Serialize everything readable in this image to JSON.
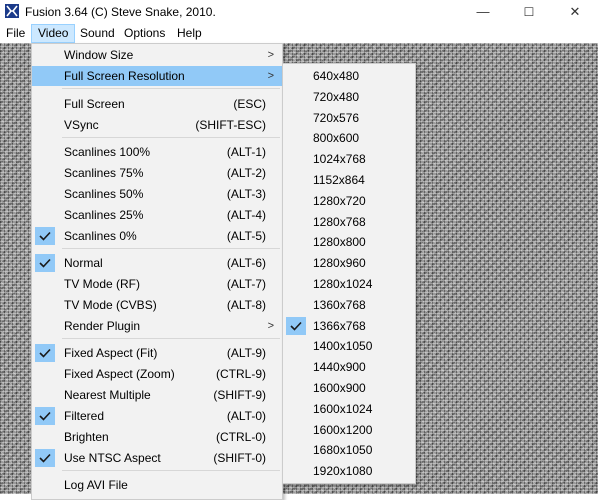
{
  "window": {
    "title": "Fusion 3.64 (C) Steve Snake, 2010.",
    "minimize": "—",
    "maximize": "☐",
    "close": "✕"
  },
  "menubar": [
    "File",
    "Video",
    "Sound",
    "Options",
    "Help"
  ],
  "video_menu": {
    "items": [
      {
        "label": "Window Size",
        "shortcut": "",
        "checked": false,
        "submenu": true
      },
      {
        "label": "Full Screen Resolution",
        "shortcut": "",
        "checked": false,
        "submenu": true,
        "highlighted": true
      },
      {
        "label": "Full Screen",
        "shortcut": "(ESC)",
        "checked": false
      },
      {
        "label": "VSync",
        "shortcut": "(SHIFT-ESC)",
        "checked": false
      },
      {
        "label": "Scanlines 100%",
        "shortcut": "(ALT-1)",
        "checked": false
      },
      {
        "label": "Scanlines 75%",
        "shortcut": "(ALT-2)",
        "checked": false
      },
      {
        "label": "Scanlines 50%",
        "shortcut": "(ALT-3)",
        "checked": false
      },
      {
        "label": "Scanlines 25%",
        "shortcut": "(ALT-4)",
        "checked": false
      },
      {
        "label": "Scanlines 0%",
        "shortcut": "(ALT-5)",
        "checked": true
      },
      {
        "label": "Normal",
        "shortcut": "(ALT-6)",
        "checked": true
      },
      {
        "label": "TV Mode (RF)",
        "shortcut": "(ALT-7)",
        "checked": false
      },
      {
        "label": "TV Mode (CVBS)",
        "shortcut": "(ALT-8)",
        "checked": false
      },
      {
        "label": "Render Plugin",
        "shortcut": "",
        "checked": false,
        "submenu": true
      },
      {
        "label": "Fixed Aspect (Fit)",
        "shortcut": "(ALT-9)",
        "checked": true
      },
      {
        "label": "Fixed Aspect (Zoom)",
        "shortcut": "(CTRL-9)",
        "checked": false
      },
      {
        "label": "Nearest Multiple",
        "shortcut": "(SHIFT-9)",
        "checked": false
      },
      {
        "label": "Filtered",
        "shortcut": "(ALT-0)",
        "checked": true
      },
      {
        "label": "Brighten",
        "shortcut": "(CTRL-0)",
        "checked": false
      },
      {
        "label": "Use NTSC Aspect",
        "shortcut": "(SHIFT-0)",
        "checked": true
      },
      {
        "label": "Log AVI File",
        "shortcut": "",
        "checked": false
      }
    ]
  },
  "resolution_menu": {
    "items": [
      {
        "label": "640x480",
        "checked": false
      },
      {
        "label": "720x480",
        "checked": false
      },
      {
        "label": "720x576",
        "checked": false
      },
      {
        "label": "800x600",
        "checked": false
      },
      {
        "label": "1024x768",
        "checked": false
      },
      {
        "label": "1152x864",
        "checked": false
      },
      {
        "label": "1280x720",
        "checked": false
      },
      {
        "label": "1280x768",
        "checked": false
      },
      {
        "label": "1280x800",
        "checked": false
      },
      {
        "label": "1280x960",
        "checked": false
      },
      {
        "label": "1280x1024",
        "checked": false
      },
      {
        "label": "1360x768",
        "checked": false
      },
      {
        "label": "1366x768",
        "checked": true
      },
      {
        "label": "1400x1050",
        "checked": false
      },
      {
        "label": "1440x900",
        "checked": false
      },
      {
        "label": "1600x900",
        "checked": false
      },
      {
        "label": "1600x1024",
        "checked": false
      },
      {
        "label": "1600x1200",
        "checked": false
      },
      {
        "label": "1680x1050",
        "checked": false
      },
      {
        "label": "1920x1080",
        "checked": false
      }
    ]
  },
  "colors": {
    "highlight": "#91c9f7",
    "menu_bg": "#f2f2f2",
    "active_menu": "#cce8ff"
  }
}
